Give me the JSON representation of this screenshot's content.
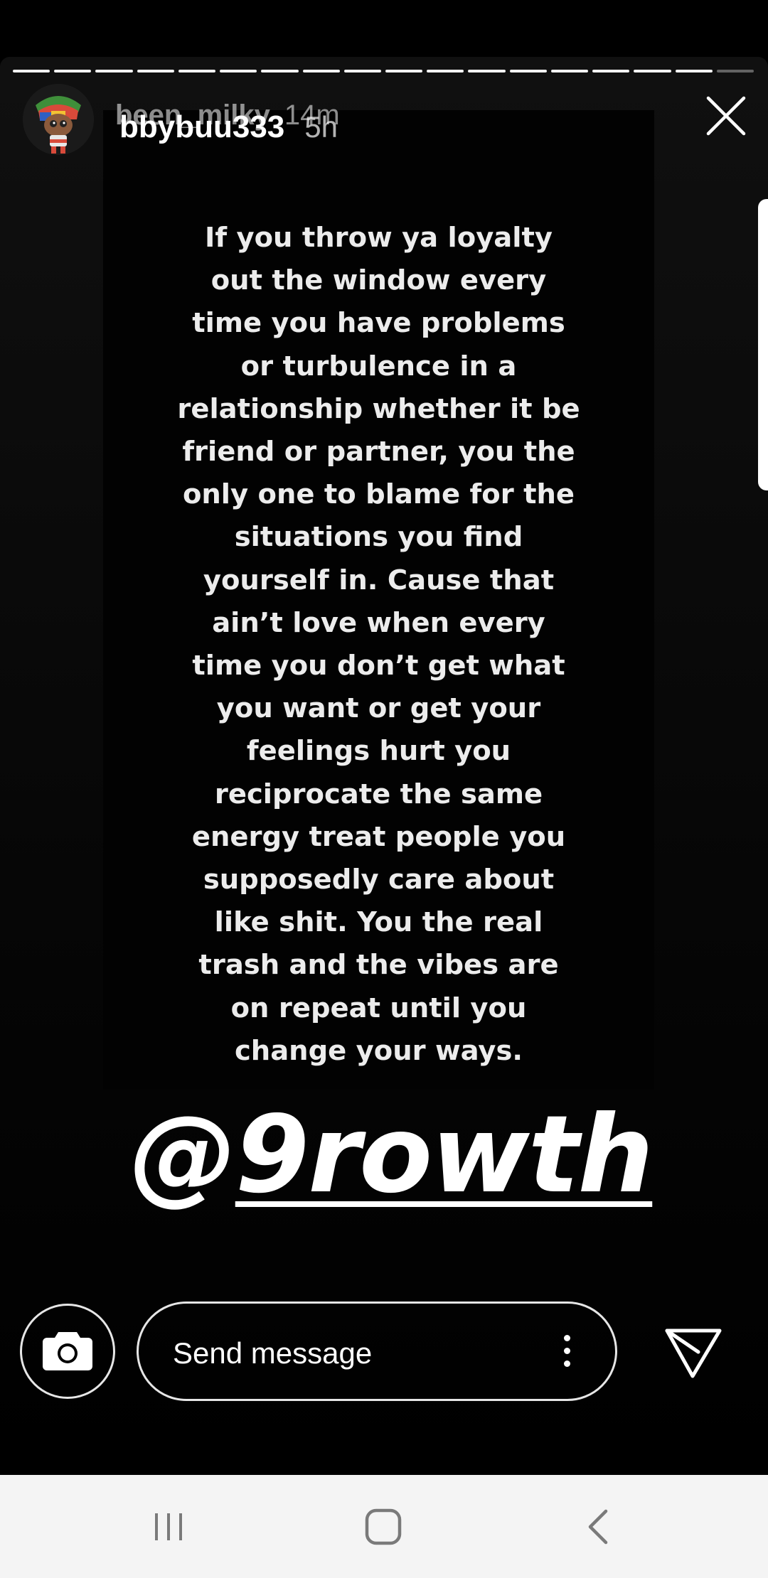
{
  "story": {
    "progress_segments": 18,
    "progress_viewed": 17,
    "username_ghost": "been_milky",
    "time_ghost": "14m",
    "username": "bbybuu333",
    "time": "5h",
    "quote_lines": [
      "If you throw ya loyalty",
      "out the window every",
      "time you have problems",
      "or turbulence in a",
      "relationship whether it be",
      "friend or partner, you the",
      "only one to blame for the",
      "situations you find",
      "yourself in.  Cause that",
      "ain’t love when every",
      "time you don’t get what",
      "you want or get your",
      "feelings hurt you",
      "reciprocate the same",
      "energy treat people you",
      "supposedly care about",
      "like shit. You the real",
      "trash and the vibes are",
      "on repeat until you",
      "change your ways."
    ],
    "handle_at": "@",
    "handle_name": "9rowth"
  },
  "reply_bar": {
    "placeholder": "Send message"
  },
  "icons": {
    "close": "close-icon",
    "camera": "camera-icon",
    "more": "more-vertical-icon",
    "send": "send-icon",
    "recents": "recents-icon",
    "home": "home-icon",
    "back": "back-icon"
  },
  "colors": {
    "background": "#000000",
    "text": "#ffffff",
    "navbar": "#f4f4f4",
    "nav_icons": "#7a7a7a"
  }
}
